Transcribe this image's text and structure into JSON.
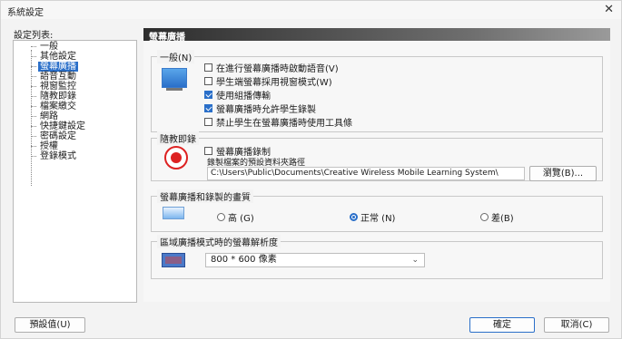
{
  "window": {
    "title": "系統設定",
    "close_glyph": "✕"
  },
  "sidebar": {
    "label": "設定列表:",
    "items": [
      {
        "label": "一般"
      },
      {
        "label": "其他設定"
      },
      {
        "label": "螢幕廣播"
      },
      {
        "label": "語音互動"
      },
      {
        "label": "視窗監控"
      },
      {
        "label": "隨教即錄"
      },
      {
        "label": "檔案繳交"
      },
      {
        "label": "網路"
      },
      {
        "label": "快捷鍵設定"
      },
      {
        "label": "密碼設定"
      },
      {
        "label": "授權"
      },
      {
        "label": "登錄模式"
      }
    ],
    "selected_index": 2
  },
  "panel": {
    "header": "螢幕廣播",
    "general": {
      "title": "一般(N)",
      "options": [
        {
          "label": "在進行螢幕廣播時啟動語音(V)",
          "checked": false
        },
        {
          "label": "學生端螢幕採用視窗模式(W)",
          "checked": false
        },
        {
          "label": "使用組播傳輸",
          "checked": true
        },
        {
          "label": "螢幕廣播時允許學生錄製",
          "checked": true
        },
        {
          "label": "禁止學生在螢幕廣播時使用工具條",
          "checked": false
        }
      ]
    },
    "recording": {
      "title": "隨教即錄",
      "enable_label": "螢幕廣播錄制",
      "enable_checked": false,
      "path_label": "錄製檔案的預設資料夾路徑",
      "path_value": "C:\\Users\\Public\\Documents\\Creative Wireless Mobile Learning System\\",
      "browse_label": "瀏覽(B)..."
    },
    "quality": {
      "title": "螢幕廣播和錄製的畫質",
      "options": [
        {
          "label": "高 (G)",
          "selected": false
        },
        {
          "label": "正常 (N)",
          "selected": true
        },
        {
          "label": "差(B)",
          "selected": false
        }
      ]
    },
    "resolution": {
      "title": "區域廣播模式時的螢幕解析度",
      "selected": "800 * 600 像素"
    }
  },
  "footer": {
    "defaults_label": "預設值(U)",
    "ok_label": "確定",
    "cancel_label": "取消(C)"
  },
  "colors": {
    "accent": "#2a6fc9",
    "record_red": "#d22222"
  }
}
